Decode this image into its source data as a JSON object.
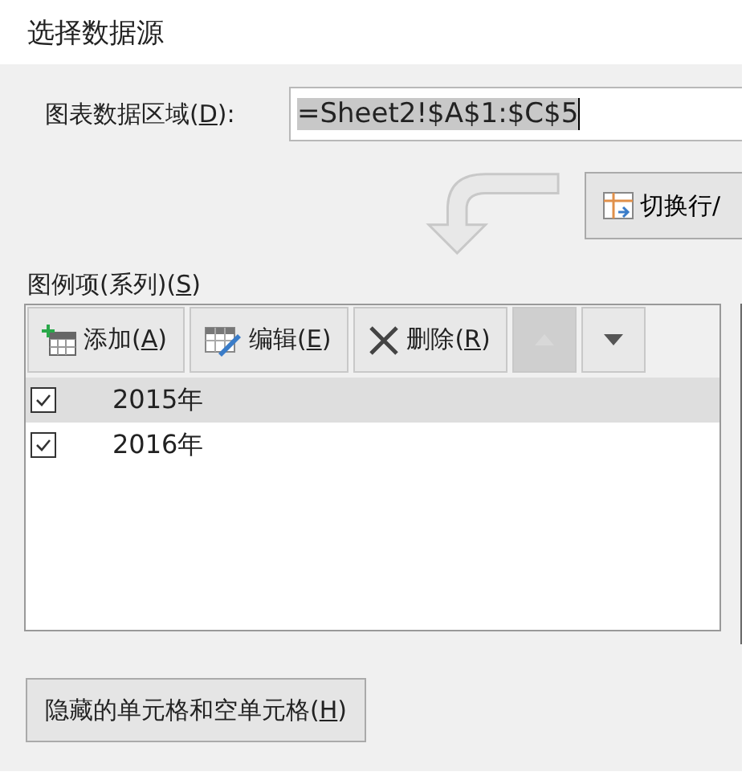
{
  "window": {
    "title": "选择数据源"
  },
  "range": {
    "label": {
      "before": "图表数据区域(",
      "key": "D",
      "after": "):"
    },
    "value": "=Sheet2!$A$1:$C$5"
  },
  "switch_button": {
    "label": "切换行/"
  },
  "legend": {
    "label": {
      "before": "图例项(系列)(",
      "key": "S",
      "after": ")"
    },
    "toolbar": [
      {
        "kind": "add",
        "before": "添加(",
        "key": "A",
        "after": ")",
        "disabled": false
      },
      {
        "kind": "edit",
        "before": "编辑(",
        "key": "E",
        "after": ")",
        "disabled": false
      },
      {
        "kind": "delete",
        "before": "删除(",
        "key": "R",
        "after": ")",
        "disabled": false
      },
      {
        "kind": "up",
        "disabled": true
      },
      {
        "kind": "down",
        "disabled": false
      }
    ],
    "series": [
      {
        "name": "2015年",
        "checked": true,
        "selected": true
      },
      {
        "name": "2016年",
        "checked": true,
        "selected": false
      }
    ]
  },
  "hidden_cells_button": {
    "before": "隐藏的单元格和空单元格(",
    "key": "H",
    "after": ")"
  }
}
